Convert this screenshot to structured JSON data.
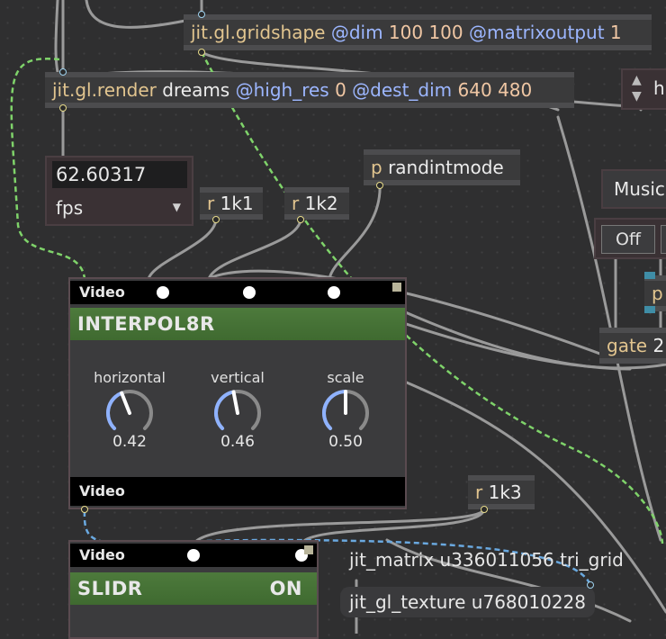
{
  "objects": {
    "gridshape": {
      "kw": "jit.gl.gridshape",
      "attr1": "@dim",
      "val1": "100 100",
      "attr2": "@matrixoutput",
      "val2": "1"
    },
    "render": {
      "kw": "jit.gl.render",
      "arg": "dreams",
      "attr1": "@high_res",
      "val1": "0",
      "attr2": "@dest_dim",
      "val2": "640 480"
    },
    "r1k1": {
      "kw": "r",
      "arg": "1k1"
    },
    "r1k2": {
      "kw": "r",
      "arg": "1k2"
    },
    "r1k3": {
      "kw": "r",
      "arg": "1k3"
    },
    "randintmode": {
      "kw": "p",
      "arg": "randintmode"
    },
    "gate": {
      "kw": "gate",
      "arg": "2"
    },
    "p_right": {
      "kw": "p"
    },
    "hi_right": {
      "arg": "hi"
    }
  },
  "fps_box": {
    "value": "62.60317",
    "unit": "fps"
  },
  "interpol8r": {
    "top_bar": "Video",
    "title": "INTERPOL8R",
    "bottom_bar": "Video",
    "knobs": [
      {
        "label": "horizontal",
        "value": "0.42",
        "fraction": 0.42
      },
      {
        "label": "vertical",
        "value": "0.46",
        "fraction": 0.46
      },
      {
        "label": "scale",
        "value": "0.50",
        "fraction": 0.5
      }
    ]
  },
  "slidr": {
    "top_bar": "Video",
    "title": "SLIDR",
    "state": "ON"
  },
  "music_box": {
    "label": "Music"
  },
  "off_button": {
    "label": "Off"
  },
  "jit_matrix": {
    "label": "jit_matrix u336011056 tri_grid"
  },
  "jit_gl_texture": {
    "label": "jit_gl_texture u768010228"
  },
  "colors": {
    "accent_green": "#4d7a3c",
    "cable_green": "#7fd36a",
    "cable_blue": "#6aa9e0",
    "keyword": "#e2c58f",
    "attribute": "#9cb6ff"
  }
}
